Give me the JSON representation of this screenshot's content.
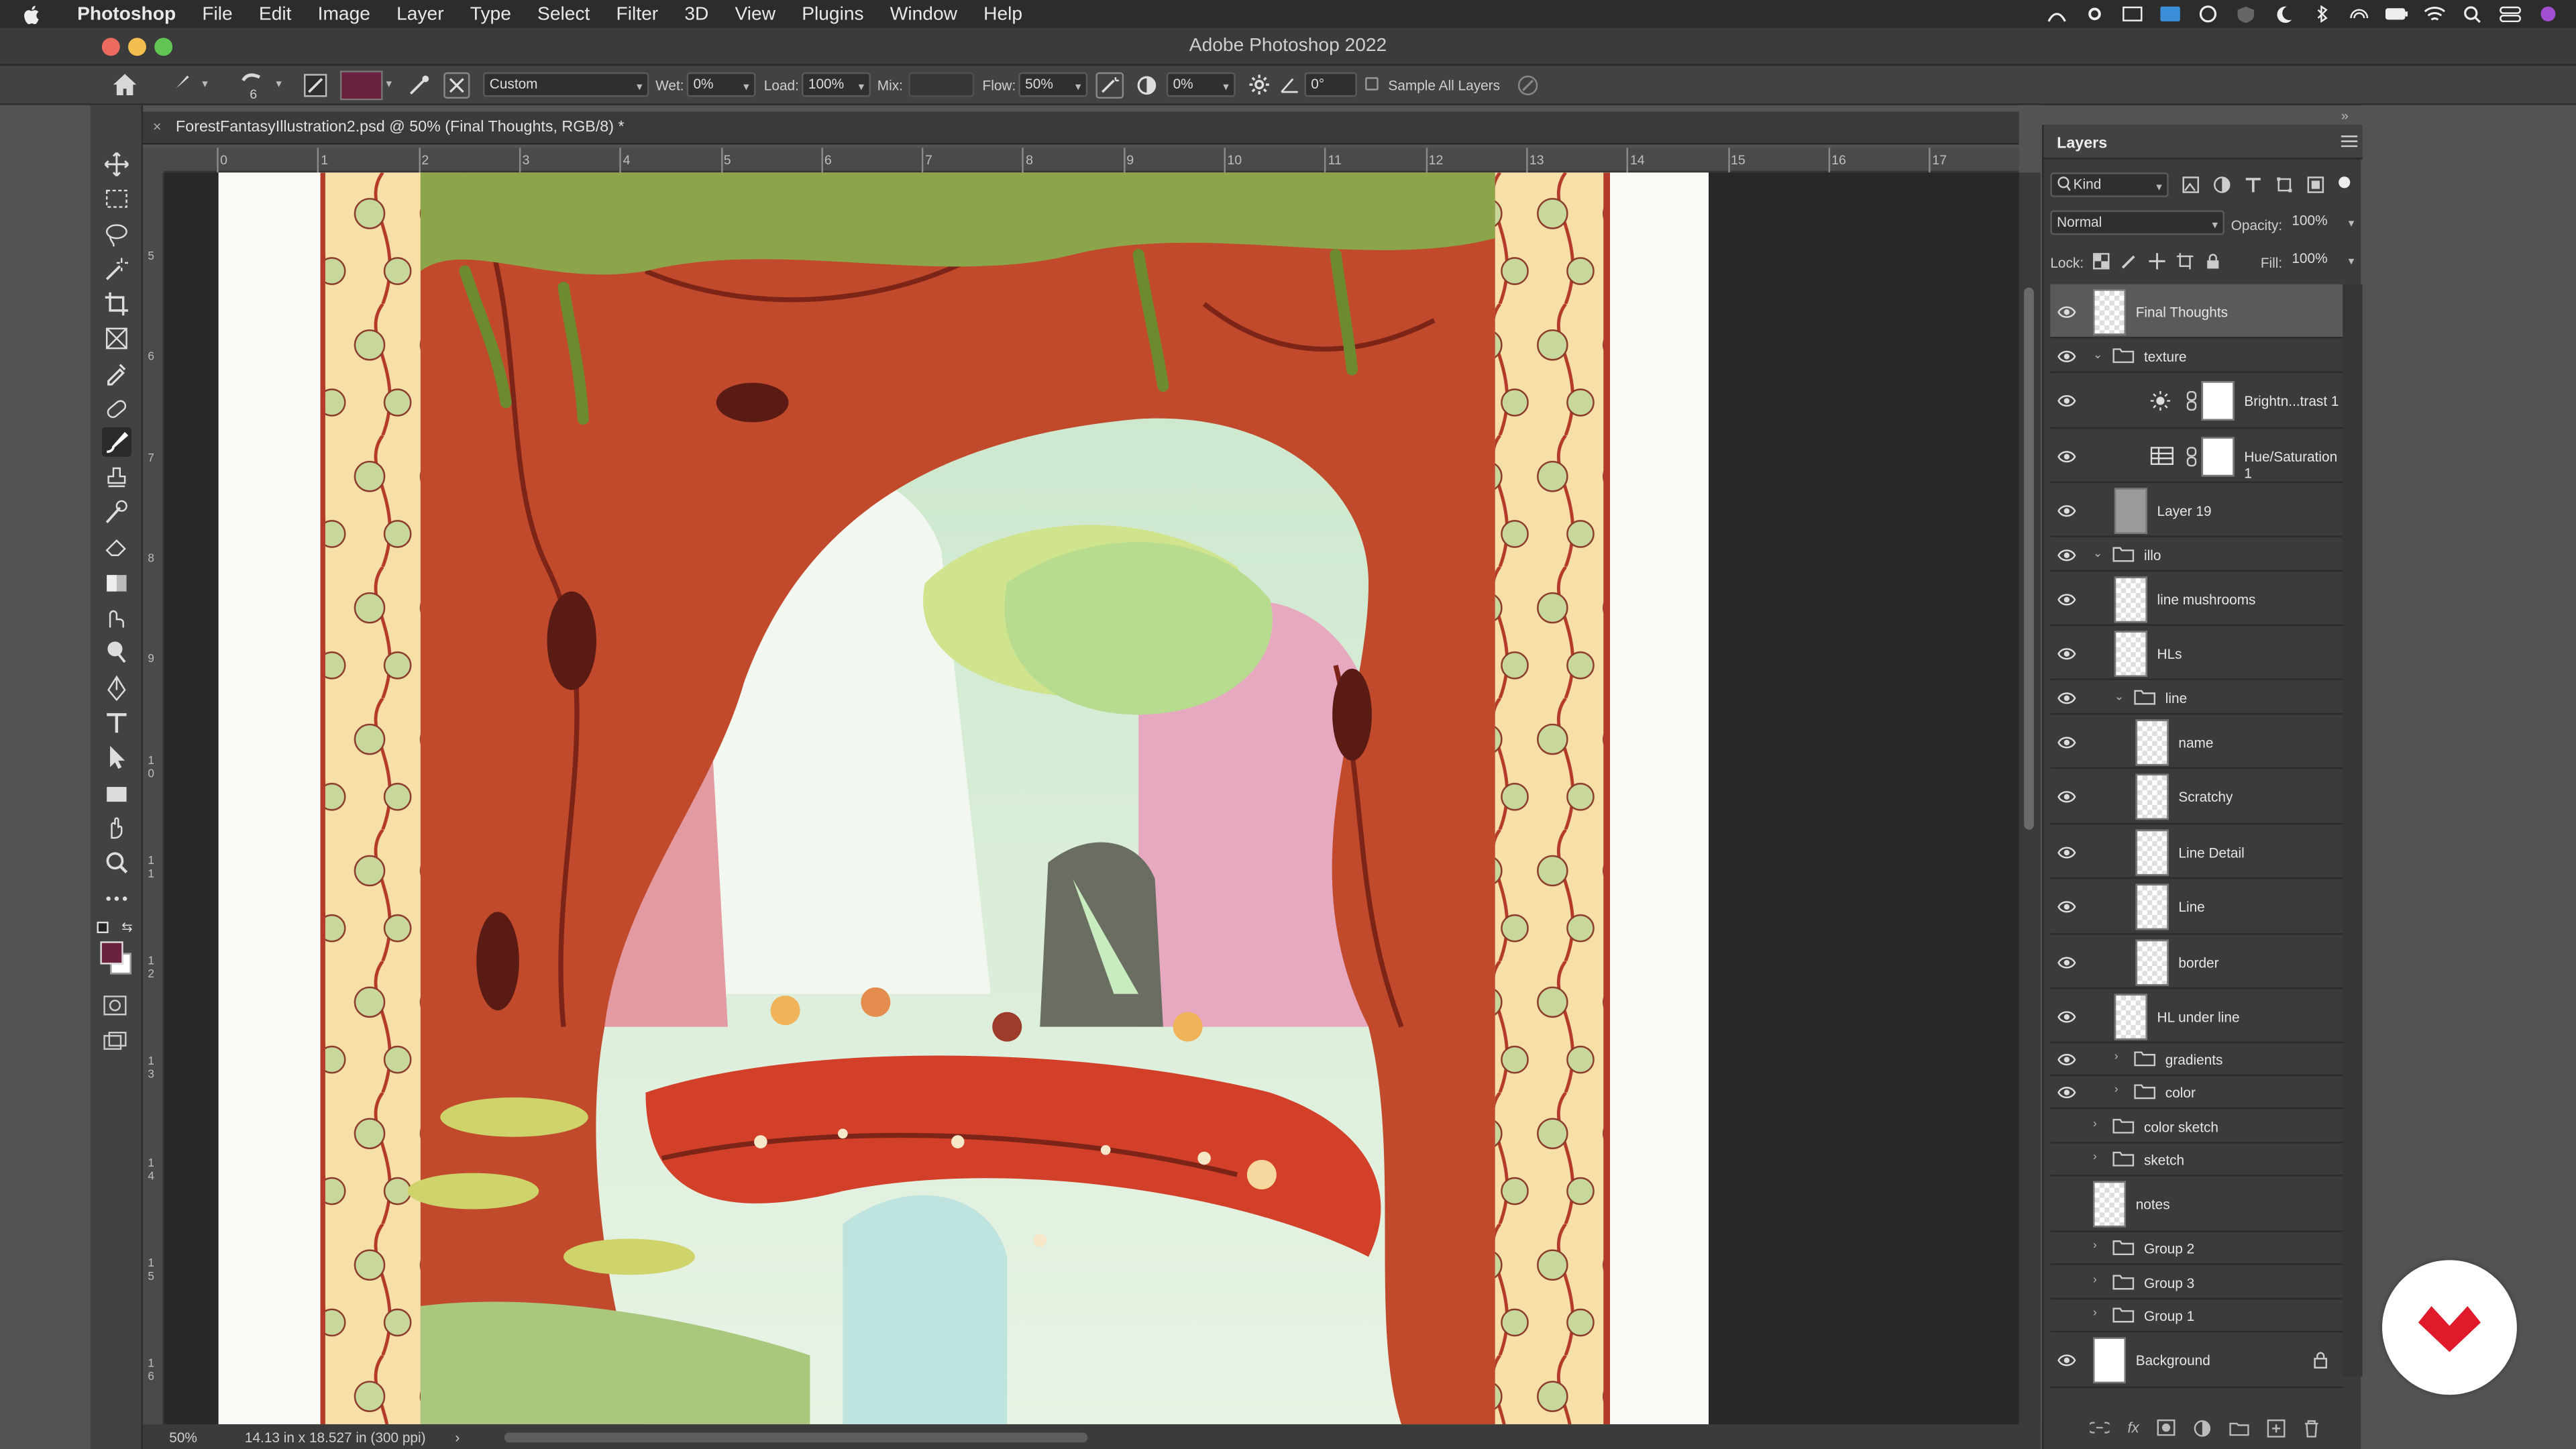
{
  "menubar": {
    "apple": "",
    "app": "Photoshop",
    "items": [
      "File",
      "Edit",
      "Image",
      "Layer",
      "Type",
      "Select",
      "Filter",
      "3D",
      "View",
      "Plugins",
      "Window",
      "Help"
    ],
    "tray_icons": [
      "antenna-icon",
      "gear-icon",
      "screen-icon",
      "keyboard-icon",
      "creative-cloud-icon",
      "shield-icon",
      "moon-icon",
      "bluetooth-icon",
      "airdrop-icon",
      "battery-icon",
      "wifi-icon",
      "search-icon",
      "control-center-icon",
      "siri-icon"
    ]
  },
  "window": {
    "title": "Adobe Photoshop 2022"
  },
  "options": {
    "brush_size": "6",
    "preset": "Custom",
    "wet_label": "Wet:",
    "wet_value": "0%",
    "load_label": "Load:",
    "load_value": "100%",
    "mix_label": "Mix:",
    "mix_value": "",
    "flow_label": "Flow:",
    "flow_value": "50%",
    "smoothing_value": "0%",
    "angle_value": "0°",
    "sample_all_label": "Sample All Layers",
    "foreground_color": "#6b2140"
  },
  "document": {
    "tab_title": "ForestFantasyIllustration2.psd @ 50% (Final Thoughts, RGB/8) *",
    "ruler_h": [
      "0",
      "1",
      "2",
      "3",
      "4",
      "5",
      "6",
      "7",
      "8",
      "9",
      "10",
      "11",
      "12",
      "13",
      "14",
      "15",
      "16",
      "17"
    ],
    "ruler_v": [
      "5",
      "6",
      "7",
      "8",
      "9",
      "1\n0",
      "1\n1",
      "1\n2",
      "1\n3",
      "1\n4",
      "1\n5",
      "1\n6"
    ]
  },
  "status": {
    "zoom": "50%",
    "size": "14.13 in x 18.527 in (300 ppi)",
    "arrow": "›"
  },
  "layers_panel": {
    "title": "Layers",
    "filter_kind": "Kind",
    "blend_mode": "Normal",
    "opacity_label": "Opacity:",
    "opacity_value": "100%",
    "lock_label": "Lock:",
    "fill_label": "Fill:",
    "fill_value": "100%",
    "layers": [
      {
        "name": "Final Thoughts",
        "kind": "layer",
        "indent": 0,
        "visible": true,
        "selected": true,
        "h": 33
      },
      {
        "name": "texture",
        "kind": "group-open",
        "indent": 0,
        "visible": true,
        "h": 21
      },
      {
        "name": "Brightn...trast 1",
        "kind": "adjust-brightness",
        "indent": 1,
        "visible": true,
        "h": 34
      },
      {
        "name": "Hue/Saturation 1",
        "kind": "adjust-hue",
        "indent": 1,
        "visible": true,
        "h": 33
      },
      {
        "name": "Layer 19",
        "kind": "layer-gray",
        "indent": 1,
        "visible": true,
        "h": 33
      },
      {
        "name": "illo",
        "kind": "group-open",
        "indent": 0,
        "visible": true,
        "h": 21
      },
      {
        "name": "line mushrooms",
        "kind": "layer",
        "indent": 1,
        "visible": true,
        "h": 33
      },
      {
        "name": "HLs",
        "kind": "layer",
        "indent": 1,
        "visible": true,
        "h": 33
      },
      {
        "name": "line",
        "kind": "group-open",
        "indent": 1,
        "visible": true,
        "h": 21
      },
      {
        "name": "name",
        "kind": "layer",
        "indent": 2,
        "visible": true,
        "h": 33
      },
      {
        "name": "Scratchy",
        "kind": "layer",
        "indent": 2,
        "visible": true,
        "h": 34
      },
      {
        "name": "Line Detail",
        "kind": "layer",
        "indent": 2,
        "visible": true,
        "h": 33
      },
      {
        "name": "Line",
        "kind": "layer",
        "indent": 2,
        "visible": true,
        "h": 34
      },
      {
        "name": "border",
        "kind": "layer",
        "indent": 2,
        "visible": true,
        "h": 33
      },
      {
        "name": "HL under line",
        "kind": "layer",
        "indent": 1,
        "visible": true,
        "h": 33
      },
      {
        "name": "gradients",
        "kind": "group-closed",
        "indent": 1,
        "visible": true,
        "h": 20
      },
      {
        "name": "color",
        "kind": "group-closed",
        "indent": 1,
        "visible": true,
        "h": 20
      },
      {
        "name": "color sketch",
        "kind": "group-closed",
        "indent": 0,
        "visible": false,
        "h": 21
      },
      {
        "name": "sketch",
        "kind": "group-closed",
        "indent": 0,
        "visible": false,
        "h": 20
      },
      {
        "name": "notes",
        "kind": "layer",
        "indent": 0,
        "visible": false,
        "h": 34
      },
      {
        "name": "Group 2",
        "kind": "group-closed",
        "indent": 0,
        "visible": false,
        "h": 20
      },
      {
        "name": "Group 3",
        "kind": "group-closed",
        "indent": 0,
        "visible": false,
        "h": 21
      },
      {
        "name": "Group 1",
        "kind": "group-closed",
        "indent": 0,
        "visible": false,
        "h": 20
      },
      {
        "name": "Background",
        "kind": "background",
        "indent": 0,
        "visible": true,
        "locked": true,
        "h": 34
      }
    ]
  },
  "tools": [
    "move-icon",
    "marquee-icon",
    "lasso-icon",
    "magic-wand-icon",
    "crop-icon",
    "frame-icon",
    "eyedropper-icon",
    "healing-icon",
    "mixer-brush-icon",
    "stamp-icon",
    "history-brush-icon",
    "eraser-icon",
    "gradient-icon",
    "smudge-icon",
    "dodge-icon",
    "pen-icon",
    "type-icon",
    "path-select-icon",
    "rectangle-icon",
    "hand-icon",
    "zoom-icon",
    "more-icon"
  ]
}
